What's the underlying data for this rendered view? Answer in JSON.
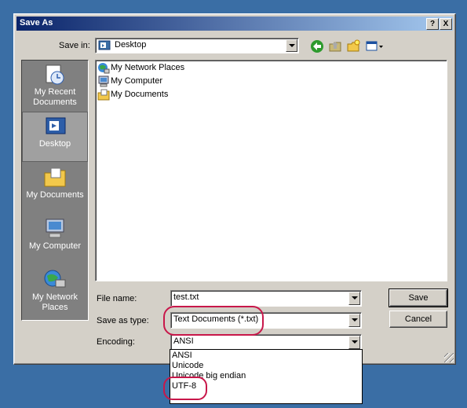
{
  "window": {
    "title": "Save As",
    "help_btn": "?",
    "close_btn": "X"
  },
  "toolbar": {
    "save_in_label": "Save in:",
    "location": "Desktop",
    "tools": [
      "back-icon",
      "up-folder-icon",
      "new-folder-icon",
      "views-menu-icon"
    ]
  },
  "places": [
    {
      "label": "My Recent Documents",
      "icon": "recent-documents-icon"
    },
    {
      "label": "Desktop",
      "icon": "desktop-icon"
    },
    {
      "label": "My Documents",
      "icon": "my-documents-icon"
    },
    {
      "label": "My Computer",
      "icon": "my-computer-icon"
    },
    {
      "label": "My Network Places",
      "icon": "network-places-icon"
    }
  ],
  "files": [
    {
      "label": "My Network Places",
      "icon": "network-places-icon"
    },
    {
      "label": "My Computer",
      "icon": "my-computer-icon"
    },
    {
      "label": "My Documents",
      "icon": "my-documents-icon"
    }
  ],
  "form": {
    "filename_label": "File name:",
    "filename_value": "test.txt",
    "savetype_label": "Save as type:",
    "savetype_value": "Text Documents (*.txt)",
    "encoding_label": "Encoding:",
    "encoding_value": "ANSI",
    "encoding_options": [
      "ANSI",
      "Unicode",
      "Unicode big endian",
      "UTF-8"
    ]
  },
  "buttons": {
    "save": "Save",
    "cancel": "Cancel"
  },
  "colors": {
    "title_start": "#0a246a",
    "title_end": "#a6caf0",
    "annotation": "#c8174a",
    "desktop_bg": "#3a6ea5"
  }
}
